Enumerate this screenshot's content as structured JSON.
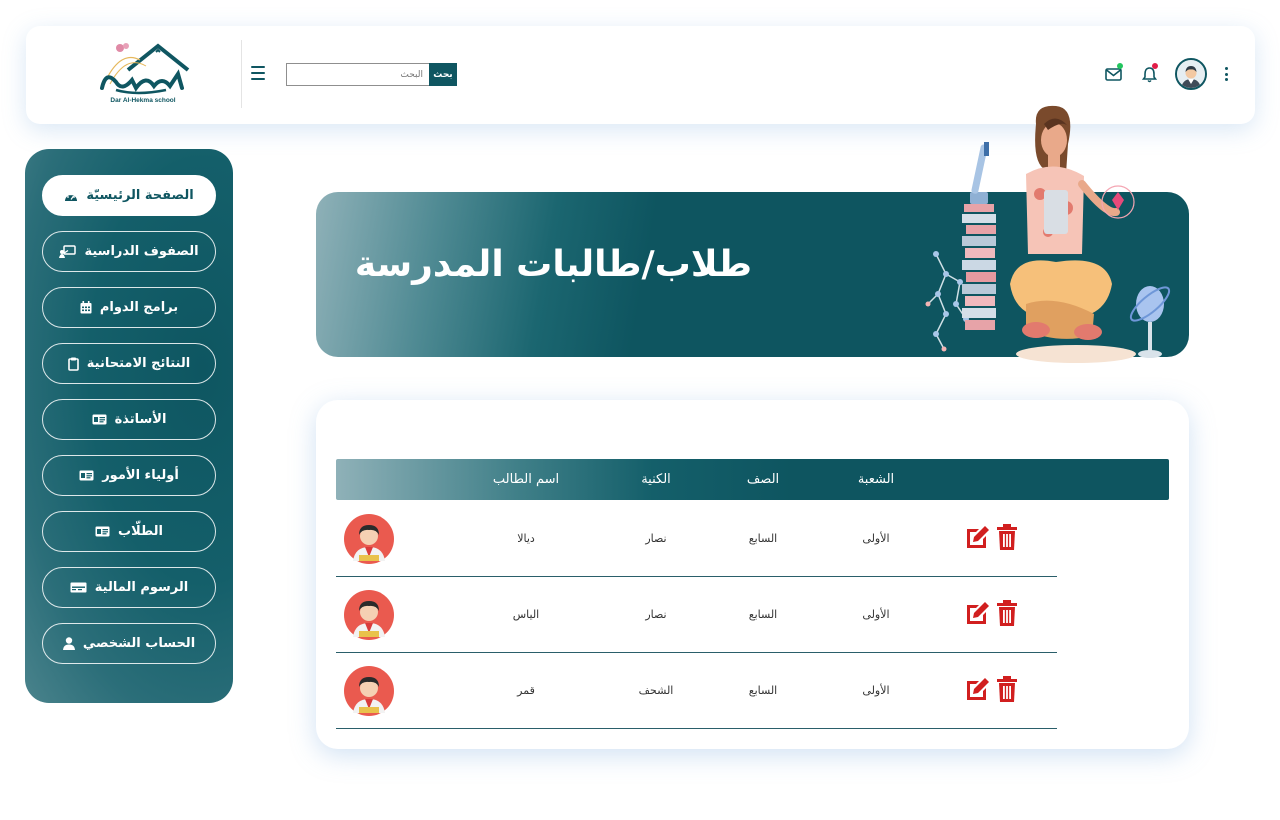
{
  "header": {
    "logo_text": "دار الحكمة",
    "logo_subtext": "Dar Al-Hekma school",
    "search_placeholder": "البحث",
    "search_button": "بحث",
    "icons": [
      "envelope-icon",
      "bell-icon",
      "user-avatar-icon",
      "more-vertical-icon"
    ],
    "notification_dot_colors": {
      "mail": "#22c55e",
      "bell": "#e11d48"
    }
  },
  "sidebar": {
    "items": [
      {
        "label": "الصفحة الرئيسيّة",
        "icon": "dashboard-gauge-icon",
        "active": true
      },
      {
        "label": "الصفوف الدراسية",
        "icon": "classroom-board-icon",
        "active": false
      },
      {
        "label": "برامج الدوام",
        "icon": "calendar-icon",
        "active": false
      },
      {
        "label": "النتائج الامتحانية",
        "icon": "clipboard-icon",
        "active": false
      },
      {
        "label": "الأساتذة",
        "icon": "id-card-icon",
        "active": false
      },
      {
        "label": "أولياء الأمور",
        "icon": "id-card-icon",
        "active": false
      },
      {
        "label": "الطلّاب",
        "icon": "id-card-icon",
        "active": false
      },
      {
        "label": "الرسوم المالية",
        "icon": "money-bill-icon",
        "active": false
      },
      {
        "label": "الحساب الشخصي",
        "icon": "user-icon",
        "active": false
      }
    ]
  },
  "banner": {
    "title": "طلاب/طالبات المدرسة"
  },
  "table": {
    "columns": [
      "اسم الطالب",
      "الكنية",
      "الصف",
      "الشعبة"
    ],
    "rows": [
      {
        "name": "ديالا",
        "surname": "نصار",
        "grade": "السابع",
        "section": "الأولى"
      },
      {
        "name": "الياس",
        "surname": "نصار",
        "grade": "السابع",
        "section": "الأولى"
      },
      {
        "name": "قمر",
        "surname": "الشحف",
        "grade": "السابع",
        "section": "الأولى"
      }
    ],
    "row_actions": [
      "edit-icon",
      "trash-icon"
    ]
  },
  "colors": {
    "primary": "#0f5661",
    "action_red": "#d11f1f"
  }
}
